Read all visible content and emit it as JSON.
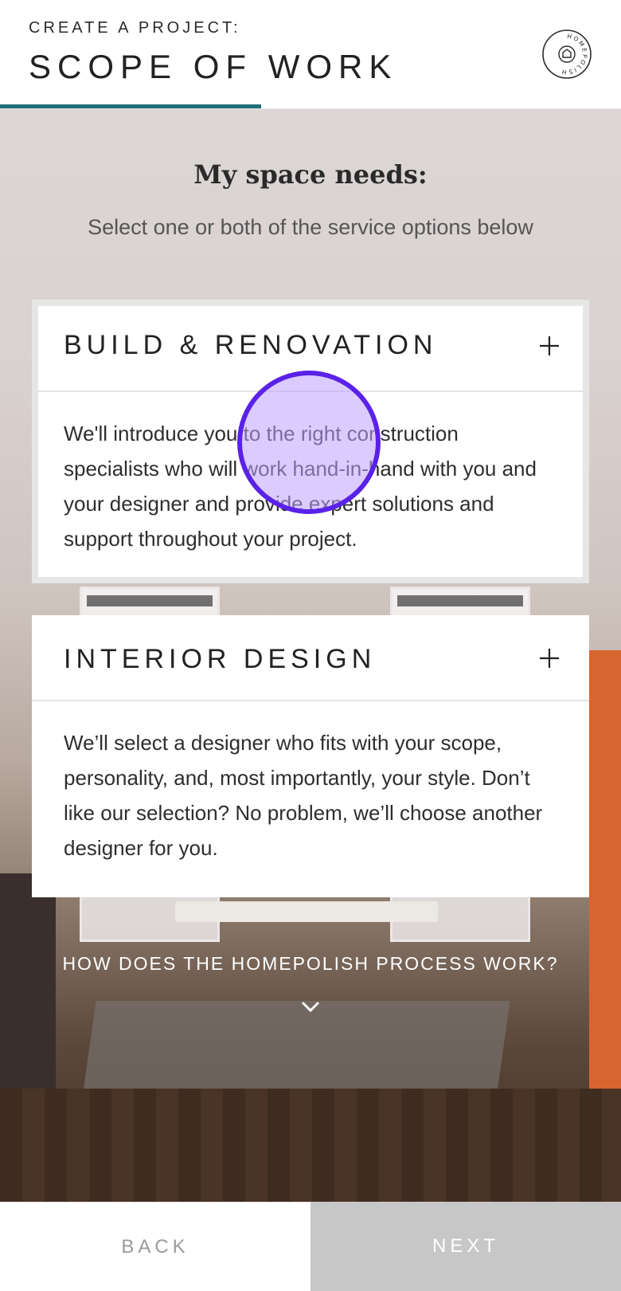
{
  "header": {
    "eyebrow": "CREATE A PROJECT:",
    "title": "SCOPE OF WORK",
    "progress": 0.42,
    "logo_text": "HOMEPOLISH"
  },
  "intro": {
    "title": "My space needs:",
    "subtitle": "Select one or both of the service options below"
  },
  "options": [
    {
      "title": "BUILD & RENOVATION",
      "icon": "plus-icon",
      "description": "We'll introduce you to the right construction specialists who will work hand-in-hand with you and your designer and provide expert solutions and support throughout your project."
    },
    {
      "title": "INTERIOR DESIGN",
      "icon": "plus-icon",
      "description": "We’ll select a designer who fits with your scope, personality, and, most importantly, your style. Don’t like our selection? No problem, we’ll choose another designer for you."
    }
  ],
  "process_link": {
    "label": "HOW DOES THE HOMEPOLISH PROCESS WORK?",
    "icon": "chevron-down-icon"
  },
  "footer": {
    "back_label": "BACK",
    "next_label": "NEXT"
  },
  "colors": {
    "accent": "#1f6f7a",
    "tap_indicator": "#5a22e8",
    "next_button_bg": "#c7c7c7"
  }
}
